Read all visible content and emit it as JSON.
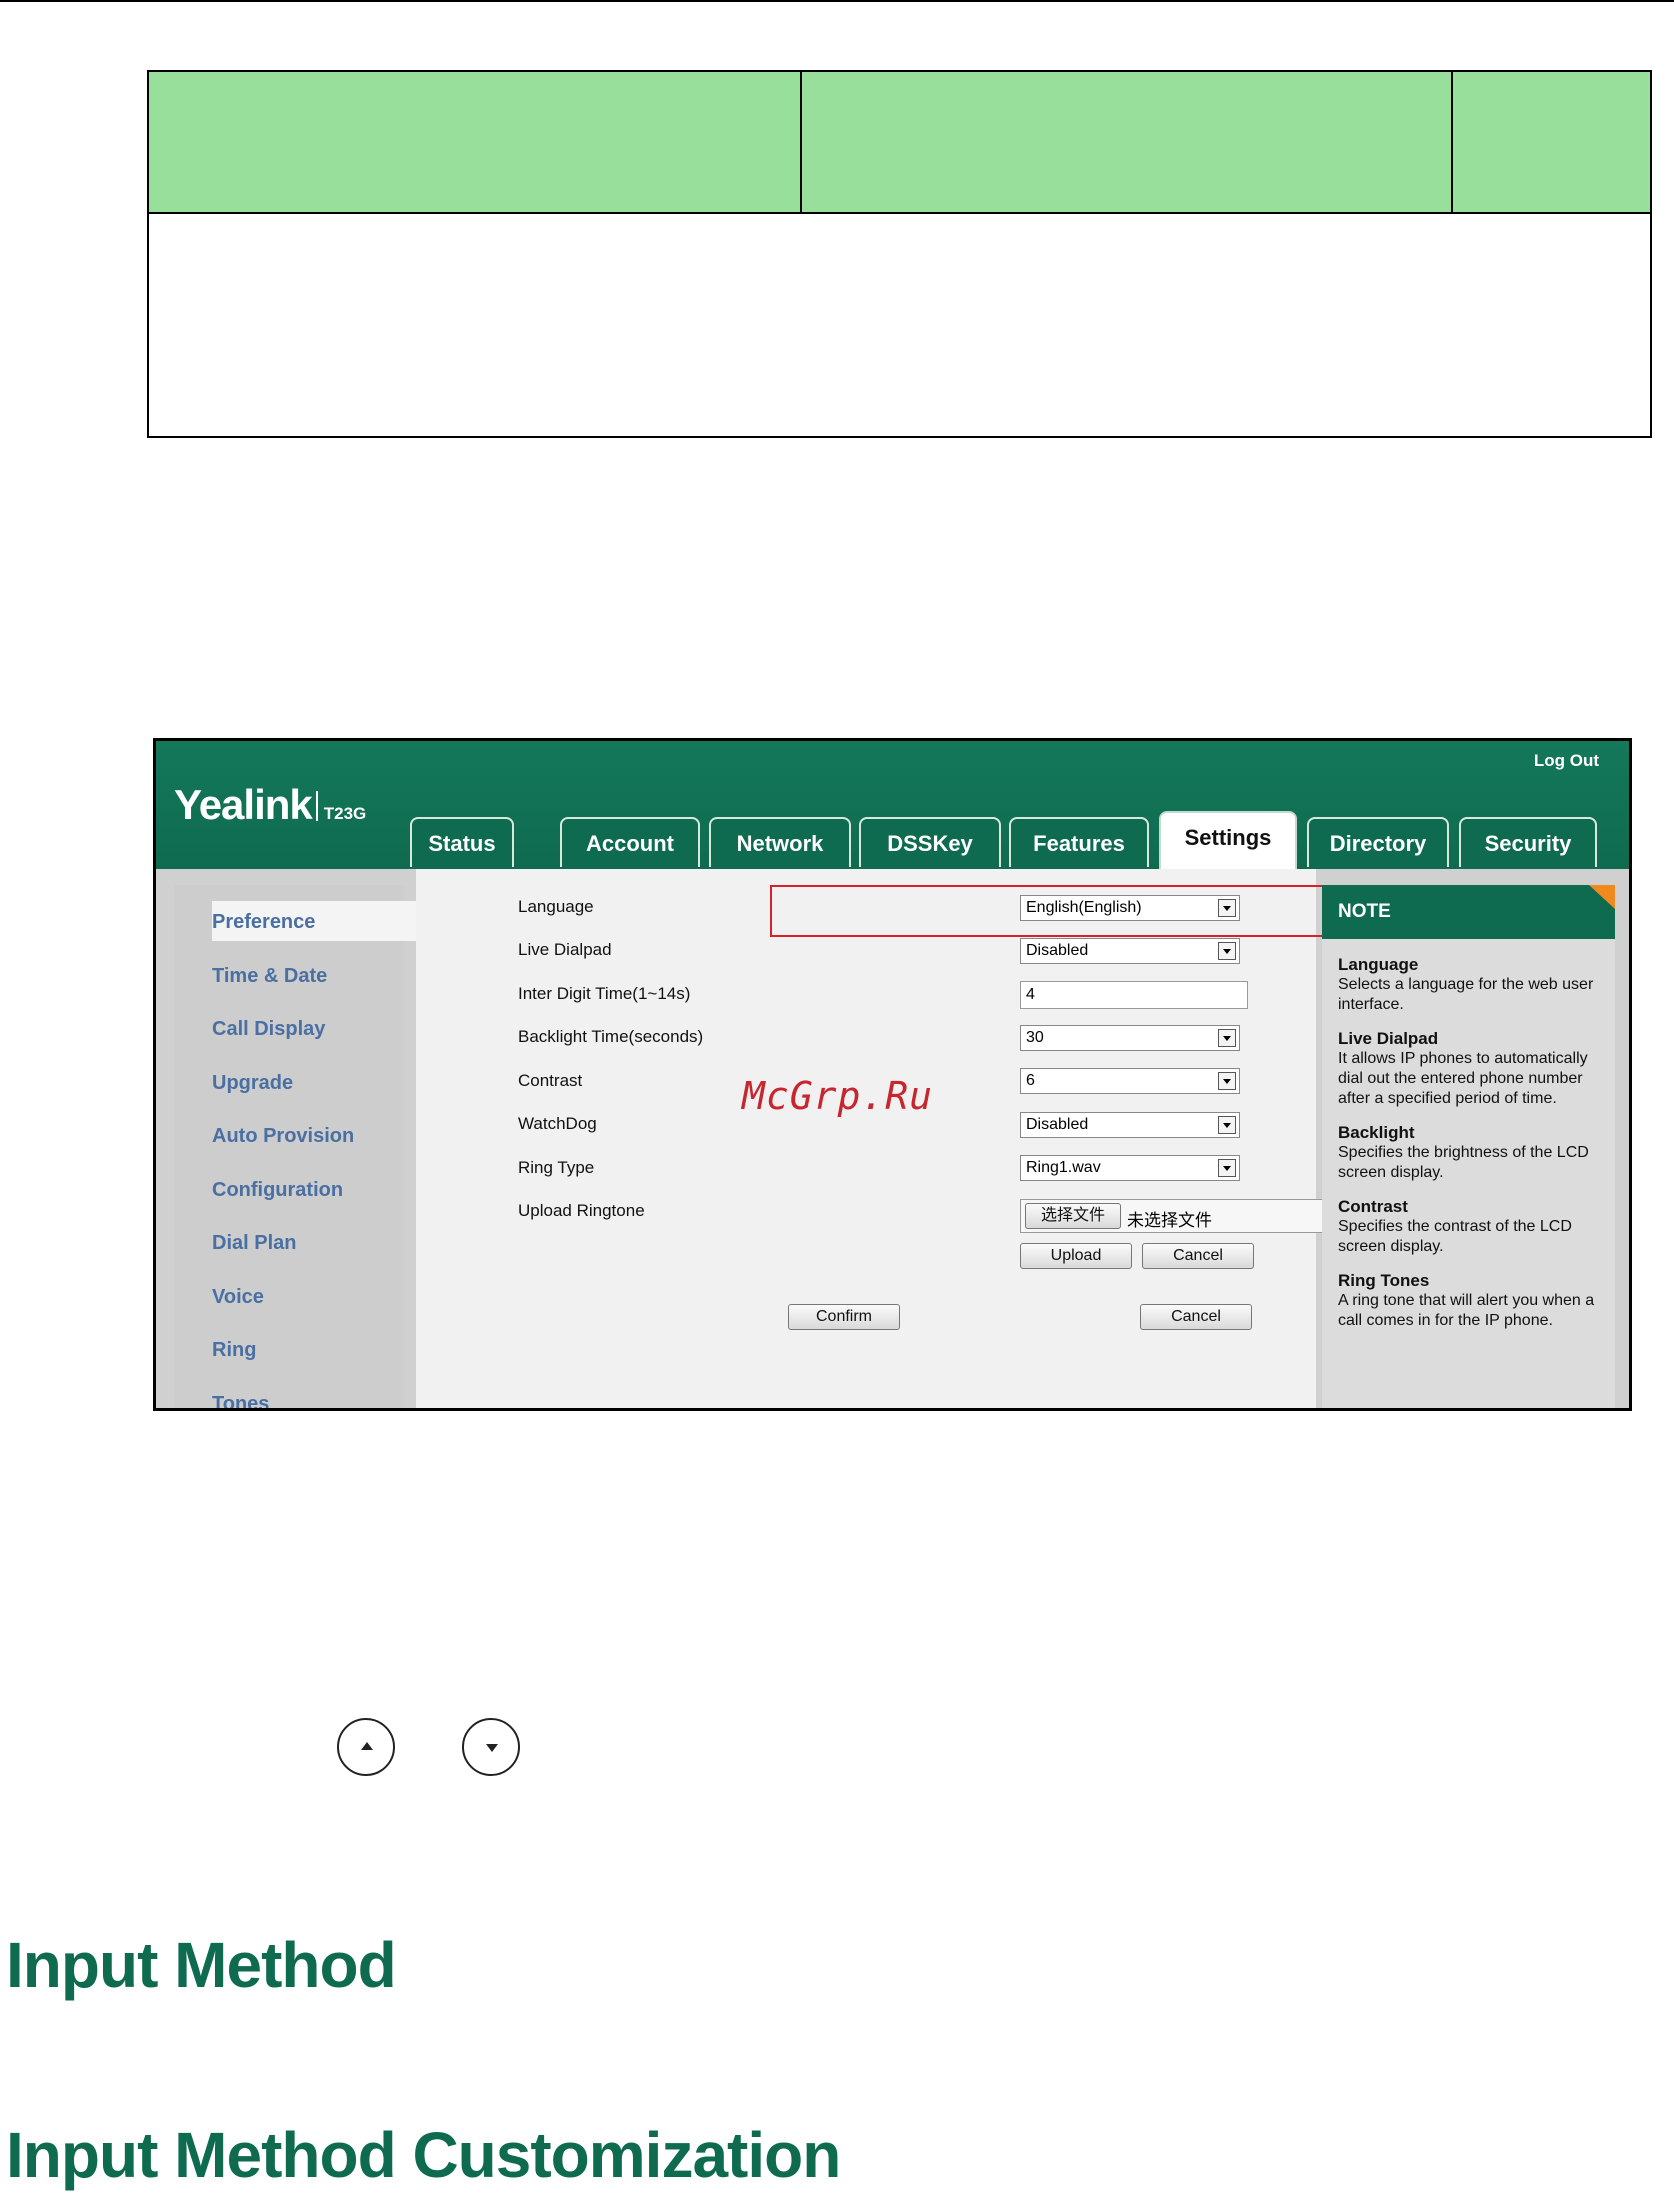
{
  "screenshot": {
    "logo": {
      "brand": "Yealink",
      "model": "T23G"
    },
    "logout": "Log Out",
    "tabs": [
      "Status",
      "Account",
      "Network",
      "DSSKey",
      "Features",
      "Settings",
      "Directory",
      "Security"
    ],
    "active_tab": "Settings",
    "sidebar": [
      "Preference",
      "Time & Date",
      "Call Display",
      "Upgrade",
      "Auto Provision",
      "Configuration",
      "Dial Plan",
      "Voice",
      "Ring",
      "Tones"
    ],
    "fields": {
      "language": {
        "label": "Language",
        "value": "English(English)"
      },
      "live_dialpad": {
        "label": "Live Dialpad",
        "value": "Disabled"
      },
      "inter_digit": {
        "label": "Inter Digit Time(1~14s)",
        "value": "4"
      },
      "backlight": {
        "label": "Backlight Time(seconds)",
        "value": "30"
      },
      "contrast": {
        "label": "Contrast",
        "value": "6"
      },
      "watchdog": {
        "label": "WatchDog",
        "value": "Disabled"
      },
      "ring_type": {
        "label": "Ring Type",
        "value": "Ring1.wav"
      },
      "upload_ringtone": {
        "label": "Upload Ringtone",
        "choose_button": "选择文件",
        "no_file": "未选择文件"
      }
    },
    "buttons": {
      "upload": "Upload",
      "cancel_upload": "Cancel",
      "confirm": "Confirm",
      "cancel": "Cancel"
    },
    "note": {
      "title": "NOTE",
      "items": [
        {
          "title": "Language",
          "text": "Selects a language for the web user interface."
        },
        {
          "title": "Live Dialpad",
          "text": "It allows IP phones to automatically dial out the entered phone number after a specified period of time."
        },
        {
          "title": "Backlight",
          "text": "Specifies the brightness of the LCD screen display."
        },
        {
          "title": "Contrast",
          "text": "Specifies the contrast of the LCD screen display."
        },
        {
          "title": "Ring Tones",
          "text": "A ring tone that will alert you when a call comes in for the IP phone."
        }
      ]
    }
  },
  "watermark": "McGrp.Ru",
  "headings": {
    "h1": "Input Method",
    "h2": "Input Method Customization"
  },
  "colors": {
    "brand_green": "#0f6b4f",
    "table_header": "#98df9c",
    "highlight_red": "#d9212a",
    "note_corner": "#f08a1e"
  },
  "icons": [
    "navigation-up-icon",
    "navigation-down-icon"
  ]
}
